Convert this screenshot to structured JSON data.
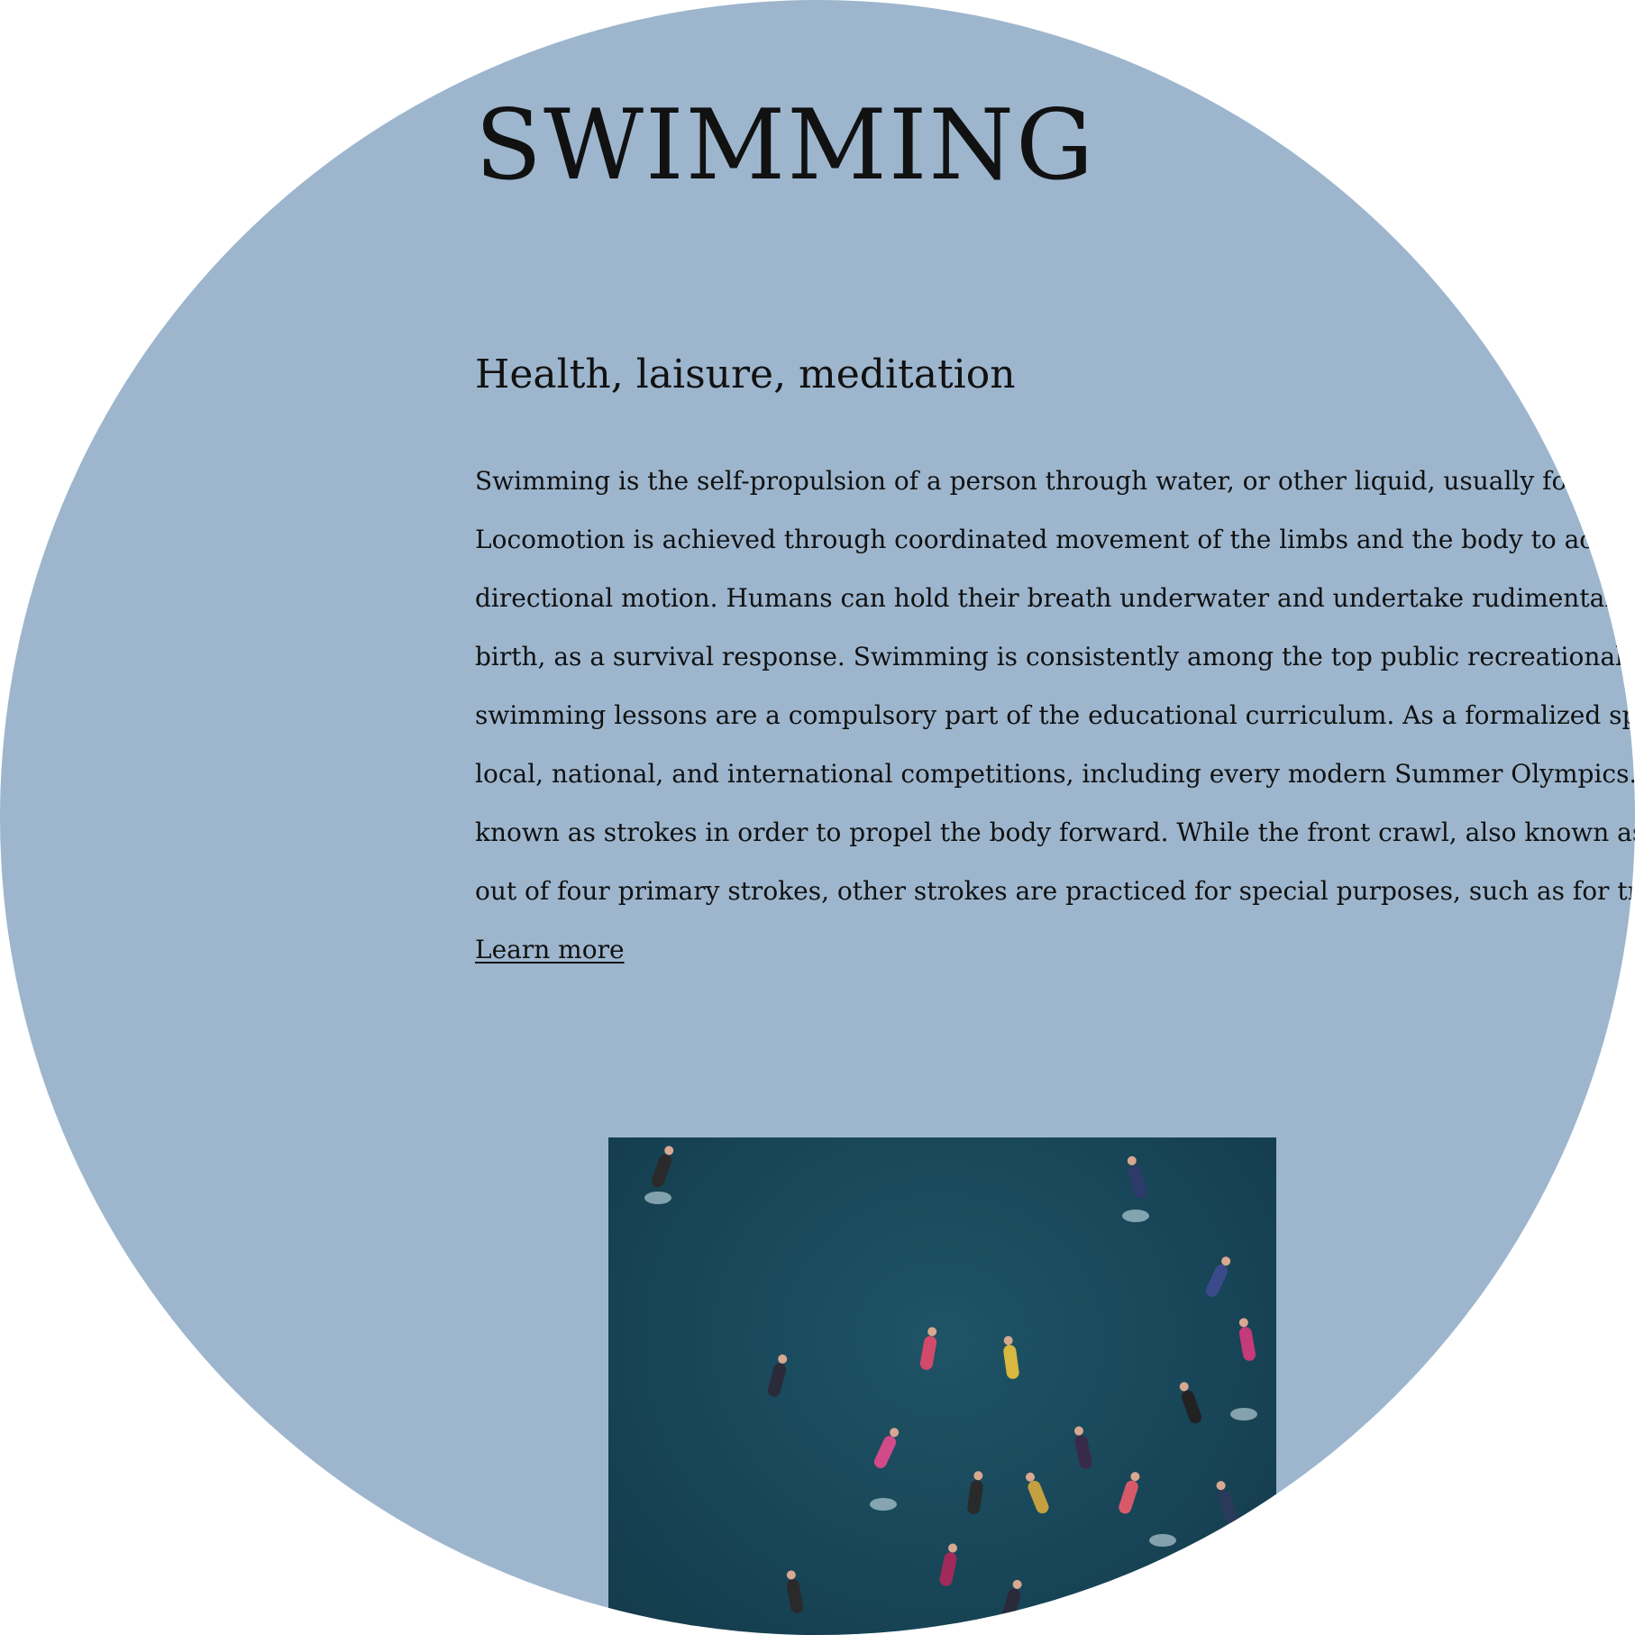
{
  "page": {
    "title": "SWIMMING",
    "subtitle": "Health, laisure, meditation",
    "body_lines": [
      "Swimming is the self-propulsion of a person through water, or other liquid, usually for re",
      "Locomotion is achieved through coordinated movement of the limbs and the body to achi",
      "directional motion. Humans can hold their breath underwater and undertake rudimentary l",
      "birth, as a survival response. Swimming is consistently among the top public recreational ac",
      "swimming lessons are a compulsory part of the educational curriculum. As a formalized spor",
      "local, national, and international competitions, including every modern Summer Olympics. Sw",
      "known as strokes in order to propel the body forward. While the front crawl, also known as fre",
      "out of four primary strokes, other strokes are practiced for special purposes, such as for trainin"
    ],
    "learn_more_label": "Learn more"
  },
  "colors": {
    "background": "#9db6ce",
    "text": "#111111",
    "water": "#184658"
  },
  "image": {
    "icon": "swimmers-aerial-photo"
  }
}
